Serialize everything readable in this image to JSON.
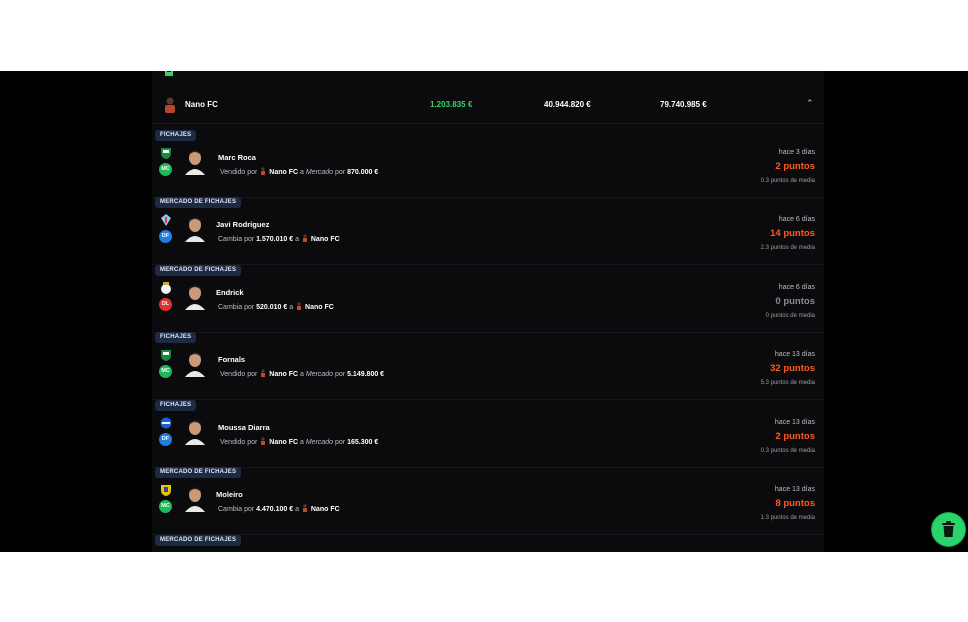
{
  "team": {
    "name": "Nano FC",
    "value_1": "1.203.835 €",
    "value_2": "40.944.820 €",
    "value_3": "79.740.985 €"
  },
  "colors": {
    "green": "#3ccf6a",
    "orange": "#ff5a1f",
    "grey_points": "#8b8b92",
    "badge_bg": "#1c2a44"
  },
  "entries": [
    {
      "badge": "FICHAJES",
      "player": "Marc Roca",
      "position": "MC",
      "pos_color": "#1fb85a",
      "club_icon": "betis-crest-icon",
      "desc": {
        "t1": "Vendido por ",
        "b1": "Nano FC",
        "t2": " a ",
        "i1": "Mercado",
        "t3": " por ",
        "b2": "870.000 €"
      },
      "when": "hace 3 días",
      "points": "2 puntos",
      "points_color": "#ff5a1f",
      "avg": "0.3 puntos de media"
    },
    {
      "badge": "MERCADO DE FICHAJES",
      "player": "Javi Rodríguez",
      "position": "DF",
      "pos_color": "#1e7fe0",
      "club_icon": "celta-crest-icon",
      "desc": {
        "t1": "Cambia por ",
        "b1": "1.570.010 €",
        "t2": " a ",
        "b2": "Nano FC"
      },
      "when": "hace 6 días",
      "points": "14 puntos",
      "points_color": "#ff5a1f",
      "avg": "2.3 puntos de media"
    },
    {
      "badge": "MERCADO DE FICHAJES",
      "player": "Endrick",
      "position": "DL",
      "pos_color": "#e0312e",
      "club_icon": "real-madrid-crest-icon",
      "desc": {
        "t1": "Cambia por ",
        "b1": "520.010 €",
        "t2": " a ",
        "b2": "Nano FC"
      },
      "when": "hace 6 días",
      "points": "0 puntos",
      "points_color": "#8b8b92",
      "avg": "0 puntos de media"
    },
    {
      "badge": "FICHAJES",
      "player": "Fornals",
      "position": "MC",
      "pos_color": "#1fb85a",
      "club_icon": "betis-crest-icon",
      "desc": {
        "t1": "Vendido por ",
        "b1": "Nano FC",
        "t2": " a ",
        "i1": "Mercado",
        "t3": " por ",
        "b2": "5.149.800 €"
      },
      "when": "hace 13 días",
      "points": "32 puntos",
      "points_color": "#ff5a1f",
      "avg": "5.3 puntos de media"
    },
    {
      "badge": "FICHAJES",
      "player": "Moussa Diarra",
      "position": "DF",
      "pos_color": "#1e7fe0",
      "club_icon": "alaves-crest-icon",
      "desc": {
        "t1": "Vendido por ",
        "b1": "Nano FC",
        "t2": " a ",
        "i1": "Mercado",
        "t3": " por ",
        "b2": "165.300 €"
      },
      "when": "hace 13 días",
      "points": "2 puntos",
      "points_color": "#ff5a1f",
      "avg": "0.3 puntos de media"
    },
    {
      "badge": "MERCADO DE FICHAJES",
      "player": "Moleiro",
      "position": "MC",
      "pos_color": "#1fb85a",
      "club_icon": "villarreal-crest-icon",
      "desc": {
        "t1": "Cambia por ",
        "b1": "4.470.100 €",
        "t2": " a ",
        "b2": "Nano FC"
      },
      "when": "hace 13 días",
      "points": "8 puntos",
      "points_color": "#ff5a1f",
      "avg": "1.3 puntos de media"
    }
  ],
  "last_badge": "MERCADO DE FICHAJES",
  "fab": {
    "icon": "trash-can-icon"
  }
}
